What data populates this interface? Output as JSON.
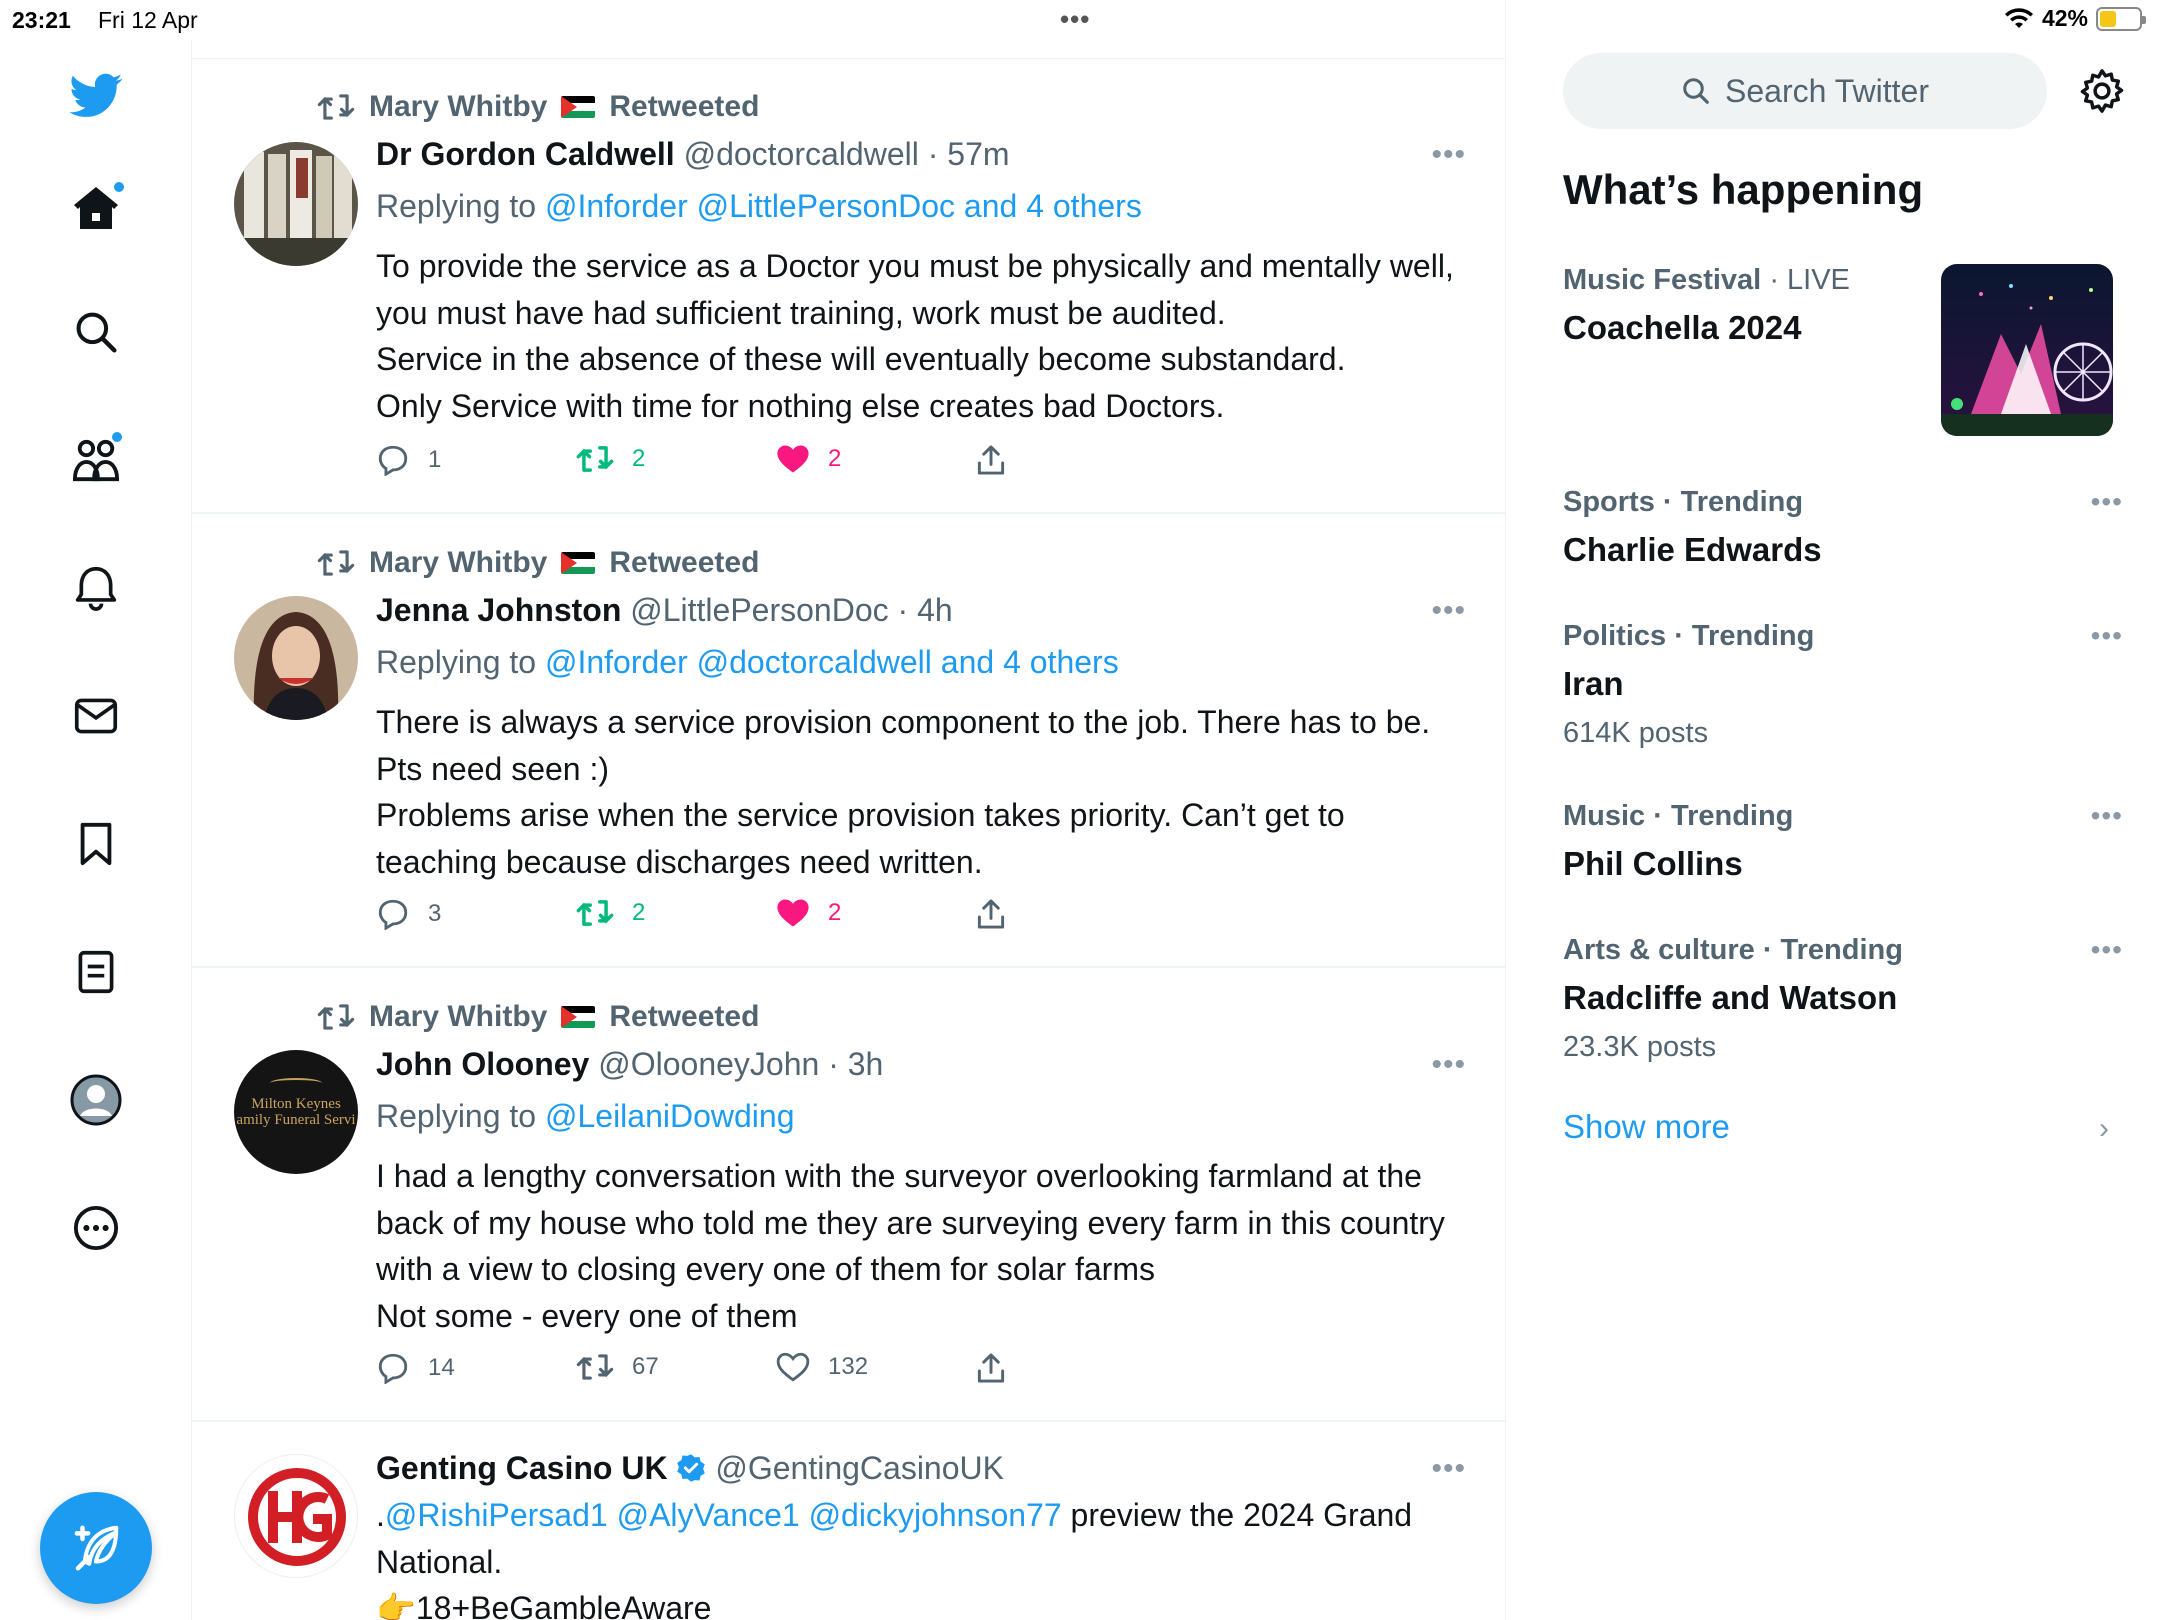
{
  "status_bar": {
    "time": "23:21",
    "date": "Fri 12 Apr",
    "battery": "42%",
    "battery_level": 0.42,
    "multitask_dots": "•••"
  },
  "nav": {
    "items": [
      "home-icon",
      "explore-icon",
      "communities-icon",
      "notifications-icon",
      "messages-icon",
      "bookmarks-icon",
      "lists-icon",
      "profile-icon",
      "more-icon"
    ],
    "compose": "compose-icon"
  },
  "tweets": [
    {
      "retweeted_by": "Mary Whitby",
      "retweeted_label": "Retweeted",
      "name": "Dr Gordon Caldwell",
      "handle": "@doctorcaldwell",
      "time": "· 57m",
      "replying_prefix": "Replying to",
      "replying_links": "@Inforder @LittlePersonDoc and 4 others",
      "body": "To provide the service as a Doctor you must be physically and mentally well, you must have had sufficient training, work must be audited.\nService in the absence of these will eventually become substandard.\nOnly Service with time for nothing else creates bad Doctors.",
      "replies": "1",
      "retweets": "2",
      "likes": "2",
      "liked": true,
      "retweeted": true
    },
    {
      "retweeted_by": "Mary Whitby",
      "retweeted_label": "Retweeted",
      "name": "Jenna Johnston",
      "handle": "@LittlePersonDoc",
      "time": "· 4h",
      "replying_prefix": "Replying to",
      "replying_links": "@Inforder @doctorcaldwell and 4 others",
      "body": "There is always a service provision component to the job. There has to be. Pts need seen :)\nProblems arise when the service provision takes priority. Can’t get to teaching because discharges need written.",
      "replies": "3",
      "retweets": "2",
      "likes": "2",
      "liked": true,
      "retweeted": true
    },
    {
      "retweeted_by": "Mary Whitby",
      "retweeted_label": "Retweeted",
      "name": "John Olooney",
      "handle": "@OlooneyJohn",
      "time": "· 3h",
      "replying_prefix": "Replying to",
      "replying_links": "@LeilaniDowding",
      "avatar_text_1": "Milton Keynes",
      "avatar_text_2": "amily Funeral Servi",
      "body": "I had a lengthy conversation with the surveyor overlooking farmland at the back of my house who told me they are surveying every farm in this country with a view to closing every one of them for solar farms\nNot some - every one of them",
      "replies": "14",
      "retweets": "67",
      "likes": "132",
      "liked": false,
      "retweeted": false
    },
    {
      "name": "Genting Casino UK",
      "handle": "@GentingCasinoUK",
      "verified": true,
      "body_prefix": ".",
      "body_links": "@RishiPersad1 @AlyVance1 @dickyjohnson77",
      "body_rest": " preview the 2024 Grand National.",
      "body_line2": "👉18+BeGambleAware"
    }
  ],
  "right": {
    "search_placeholder": "Search Twitter",
    "title": "What’s happening",
    "trends": [
      {
        "category": "Music Festival",
        "badge": "· LIVE",
        "name": "Coachella 2024",
        "count": ""
      },
      {
        "category": "Sports · Trending",
        "name": "Charlie Edwards",
        "count": ""
      },
      {
        "category": "Politics · Trending",
        "name": "Iran",
        "count": "614K posts"
      },
      {
        "category": "Music · Trending",
        "name": "Phil Collins",
        "count": ""
      },
      {
        "category": "Arts & culture · Trending",
        "name": "Radcliffe and Watson",
        "count": "23.3K posts"
      }
    ],
    "show_more": "Show more",
    "more_dots": "•••"
  },
  "colors": {
    "accent": "#1d9bf0",
    "retweet_green": "#00ba7c",
    "like_pink": "#f91880",
    "secondary_text": "#536471"
  }
}
